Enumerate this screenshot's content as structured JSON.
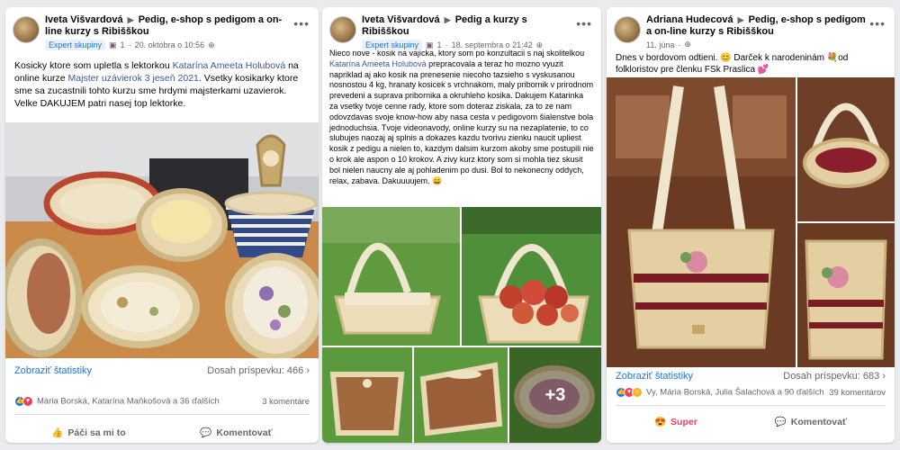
{
  "posts": [
    {
      "author": "Iveta Višvardová",
      "group": "Pedig, e-shop s pedigom a on-line kurzy s Ribišškou",
      "badge": "Expert skupiny",
      "badge_count": "1",
      "date": "20. októbra o 10:56",
      "text_a": "Kosicky ktore som upletla s lektorkou ",
      "mention": "Katarína Ameeta Holubová",
      "text_b": " na online kurze ",
      "mention2": "Majster uzávierok 3 jeseň 2021",
      "text_c": ". Vsetky kosikarky ktore sme sa zucastnili tohto kurzu sme hrdymi majsterkami uzavierok. Velke DAKUJEM patri nasej top lektorke.",
      "stats_label": "Zobraziť štatistiky",
      "reach_label": "Dosah príspevku: 466",
      "reactions_text": "Mária Borská, Katarína Maňkošová a 36 ďalších",
      "comments_text": "3 komentáre",
      "like_label": "Páči sa mi to",
      "comment_label": "Komentovať"
    },
    {
      "author": "Iveta Višvardová",
      "group": "Pedig a kurzy s Ribišškou",
      "badge": "Expert skupiny",
      "badge_count": "1",
      "date": "18. septembra o 21:42",
      "text_a": "Nieco nove - kosik na vajicka, ktory som po konzultacii s naj skolitelkou ",
      "mention": "Katarína Ameeta Holubová",
      "text_b": " prepracovala a teraz ho mozno vyuzit napriklad aj ako kosik na prenesenie niecoho tazsieho s vyskusanou nosnostou 4 kg, hranaty kosicek s vrchnakom, maly pribornik v prirodnom prevedeni a suprava pribornika a okruhleho kosika. Dakujem Katarinka za vsetky tvoje cenne rady, ktore som doteraz ziskala, za to ze nam odovzdavas svoje know-how aby nasa cesta v pedigovom šialenstve bola jednoduchsia. Tvoje videonavody, online kurzy su na nezaplatenie, to co slubujes naozaj aj splnis a dokazes kazdu tvorivu zienku naucit upliest kosik z pedigu a nielen to, kazdym dalsim kurzom akoby sme postupili nie o krok ale aspon o 10 krokov. A zivy kurz ktory som si mohla tiez skusit bol nielen naucny ale aj pohladenim po dusi. Bol to nekonecny oddych, relax, zabava. Dakuuuujem. 😀",
      "more_count": "+3"
    },
    {
      "author": "Adriana Hudecová",
      "group": "Pedig, e-shop s pedigom a on-line kurzy s Ribišškou",
      "date": "11. júna",
      "text_a": "Dnes v bordovom odtieni. 😊 Darček k narodeninám 💐od folkloristov pre členku FSk Praslica 💕",
      "stats_label": "Zobraziť štatistiky",
      "reach_label": "Dosah príspevku: 683",
      "reactions_text": "Vy, Mária Borská, Julia Šalachová a 90 ďalších",
      "comments_text": "39 komentárov",
      "super_label": "Super",
      "comment_label": "Komentovať"
    }
  ],
  "icons": {
    "globe": "globe-icon",
    "more": "more-options-icon",
    "chevron": "chevron-right-icon",
    "like": "thumbs-up-icon",
    "comment": "comment-icon",
    "love": "heart-icon"
  },
  "colors": {
    "fb_blue": "#1b74e4",
    "love_red": "#f33e58",
    "care_yellow": "#f7b125"
  }
}
